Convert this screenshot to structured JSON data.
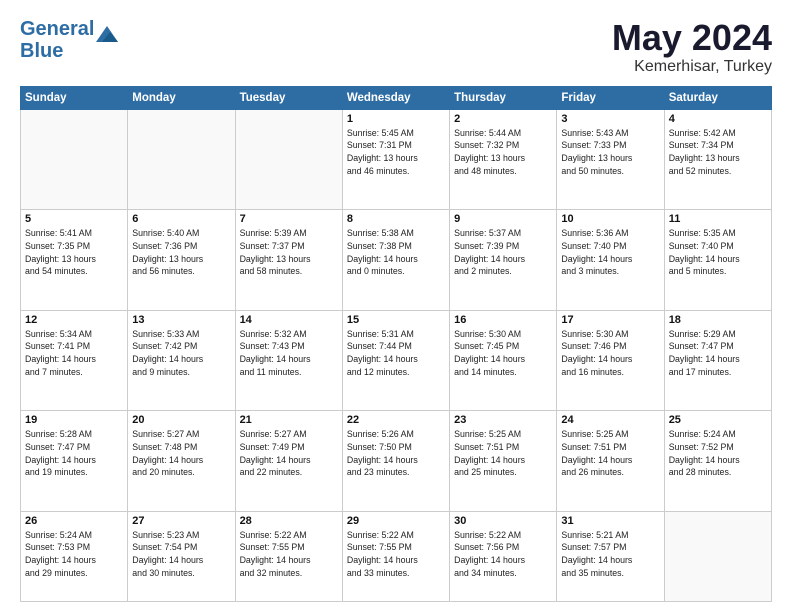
{
  "header": {
    "logo_line1": "General",
    "logo_line2": "Blue",
    "month_year": "May 2024",
    "location": "Kemerhisar, Turkey"
  },
  "days_of_week": [
    "Sunday",
    "Monday",
    "Tuesday",
    "Wednesday",
    "Thursday",
    "Friday",
    "Saturday"
  ],
  "weeks": [
    [
      {
        "num": "",
        "info": ""
      },
      {
        "num": "",
        "info": ""
      },
      {
        "num": "",
        "info": ""
      },
      {
        "num": "1",
        "info": "Sunrise: 5:45 AM\nSunset: 7:31 PM\nDaylight: 13 hours\nand 46 minutes."
      },
      {
        "num": "2",
        "info": "Sunrise: 5:44 AM\nSunset: 7:32 PM\nDaylight: 13 hours\nand 48 minutes."
      },
      {
        "num": "3",
        "info": "Sunrise: 5:43 AM\nSunset: 7:33 PM\nDaylight: 13 hours\nand 50 minutes."
      },
      {
        "num": "4",
        "info": "Sunrise: 5:42 AM\nSunset: 7:34 PM\nDaylight: 13 hours\nand 52 minutes."
      }
    ],
    [
      {
        "num": "5",
        "info": "Sunrise: 5:41 AM\nSunset: 7:35 PM\nDaylight: 13 hours\nand 54 minutes."
      },
      {
        "num": "6",
        "info": "Sunrise: 5:40 AM\nSunset: 7:36 PM\nDaylight: 13 hours\nand 56 minutes."
      },
      {
        "num": "7",
        "info": "Sunrise: 5:39 AM\nSunset: 7:37 PM\nDaylight: 13 hours\nand 58 minutes."
      },
      {
        "num": "8",
        "info": "Sunrise: 5:38 AM\nSunset: 7:38 PM\nDaylight: 14 hours\nand 0 minutes."
      },
      {
        "num": "9",
        "info": "Sunrise: 5:37 AM\nSunset: 7:39 PM\nDaylight: 14 hours\nand 2 minutes."
      },
      {
        "num": "10",
        "info": "Sunrise: 5:36 AM\nSunset: 7:40 PM\nDaylight: 14 hours\nand 3 minutes."
      },
      {
        "num": "11",
        "info": "Sunrise: 5:35 AM\nSunset: 7:40 PM\nDaylight: 14 hours\nand 5 minutes."
      }
    ],
    [
      {
        "num": "12",
        "info": "Sunrise: 5:34 AM\nSunset: 7:41 PM\nDaylight: 14 hours\nand 7 minutes."
      },
      {
        "num": "13",
        "info": "Sunrise: 5:33 AM\nSunset: 7:42 PM\nDaylight: 14 hours\nand 9 minutes."
      },
      {
        "num": "14",
        "info": "Sunrise: 5:32 AM\nSunset: 7:43 PM\nDaylight: 14 hours\nand 11 minutes."
      },
      {
        "num": "15",
        "info": "Sunrise: 5:31 AM\nSunset: 7:44 PM\nDaylight: 14 hours\nand 12 minutes."
      },
      {
        "num": "16",
        "info": "Sunrise: 5:30 AM\nSunset: 7:45 PM\nDaylight: 14 hours\nand 14 minutes."
      },
      {
        "num": "17",
        "info": "Sunrise: 5:30 AM\nSunset: 7:46 PM\nDaylight: 14 hours\nand 16 minutes."
      },
      {
        "num": "18",
        "info": "Sunrise: 5:29 AM\nSunset: 7:47 PM\nDaylight: 14 hours\nand 17 minutes."
      }
    ],
    [
      {
        "num": "19",
        "info": "Sunrise: 5:28 AM\nSunset: 7:47 PM\nDaylight: 14 hours\nand 19 minutes."
      },
      {
        "num": "20",
        "info": "Sunrise: 5:27 AM\nSunset: 7:48 PM\nDaylight: 14 hours\nand 20 minutes."
      },
      {
        "num": "21",
        "info": "Sunrise: 5:27 AM\nSunset: 7:49 PM\nDaylight: 14 hours\nand 22 minutes."
      },
      {
        "num": "22",
        "info": "Sunrise: 5:26 AM\nSunset: 7:50 PM\nDaylight: 14 hours\nand 23 minutes."
      },
      {
        "num": "23",
        "info": "Sunrise: 5:25 AM\nSunset: 7:51 PM\nDaylight: 14 hours\nand 25 minutes."
      },
      {
        "num": "24",
        "info": "Sunrise: 5:25 AM\nSunset: 7:51 PM\nDaylight: 14 hours\nand 26 minutes."
      },
      {
        "num": "25",
        "info": "Sunrise: 5:24 AM\nSunset: 7:52 PM\nDaylight: 14 hours\nand 28 minutes."
      }
    ],
    [
      {
        "num": "26",
        "info": "Sunrise: 5:24 AM\nSunset: 7:53 PM\nDaylight: 14 hours\nand 29 minutes."
      },
      {
        "num": "27",
        "info": "Sunrise: 5:23 AM\nSunset: 7:54 PM\nDaylight: 14 hours\nand 30 minutes."
      },
      {
        "num": "28",
        "info": "Sunrise: 5:22 AM\nSunset: 7:55 PM\nDaylight: 14 hours\nand 32 minutes."
      },
      {
        "num": "29",
        "info": "Sunrise: 5:22 AM\nSunset: 7:55 PM\nDaylight: 14 hours\nand 33 minutes."
      },
      {
        "num": "30",
        "info": "Sunrise: 5:22 AM\nSunset: 7:56 PM\nDaylight: 14 hours\nand 34 minutes."
      },
      {
        "num": "31",
        "info": "Sunrise: 5:21 AM\nSunset: 7:57 PM\nDaylight: 14 hours\nand 35 minutes."
      },
      {
        "num": "",
        "info": ""
      }
    ]
  ]
}
